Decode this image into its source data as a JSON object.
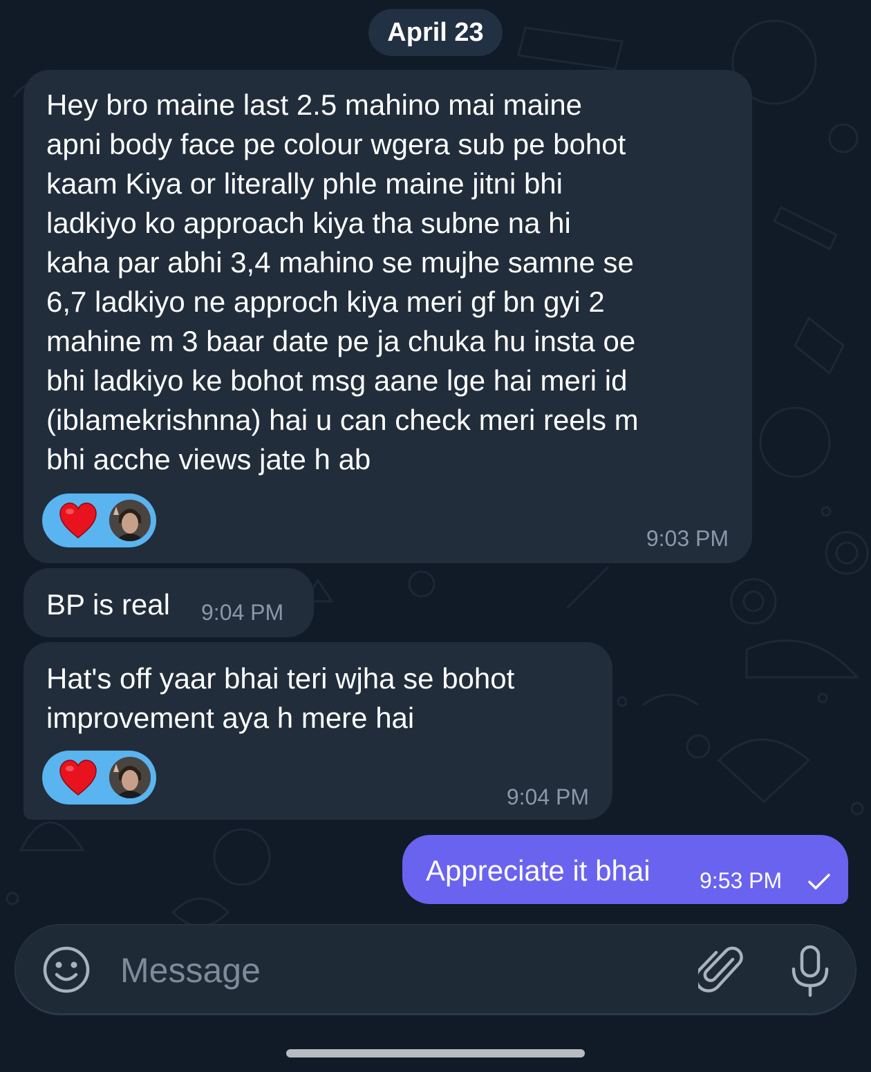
{
  "date_chip": "April 23",
  "messages": [
    {
      "text": "Hey bro maine last 2.5 mahino mai maine\napni body face pe colour wgera sub pe bohot\nkaam Kiya or literally phle maine jitni bhi\nladkiyo ko approach kiya tha subne na hi\nkaha par abhi 3,4 mahino se mujhe samne se\n6,7 ladkiyo ne approch kiya meri gf bn gyi 2\nmahine m 3 baar date pe ja chuka hu insta oe\nbhi ladkiyo ke bohot msg aane lge hai meri id\n(iblamekrishnna) hai u can check meri reels m\nbhi acche views jate h ab",
      "time": "9:03 PM",
      "reaction": "heart"
    },
    {
      "text": "BP is real",
      "time": "9:04 PM"
    },
    {
      "text": "Hat's off yaar bhai teri wjha se bohot\nimprovement aya h mere hai",
      "time": "9:04 PM",
      "reaction": "heart"
    },
    {
      "text": "Appreciate it bhai",
      "time": "9:53 PM",
      "status": "sent-check"
    }
  ],
  "composer": {
    "placeholder": "Message",
    "icons": [
      "emoji-icon",
      "attach-icon",
      "mic-icon"
    ]
  },
  "colors": {
    "background": "#111b27",
    "incoming_bubble": "#212d3b",
    "outgoing_bubble": "#6a63f0",
    "reaction_pill": "#5ab4f0",
    "timestamp": "#8a98a8"
  }
}
